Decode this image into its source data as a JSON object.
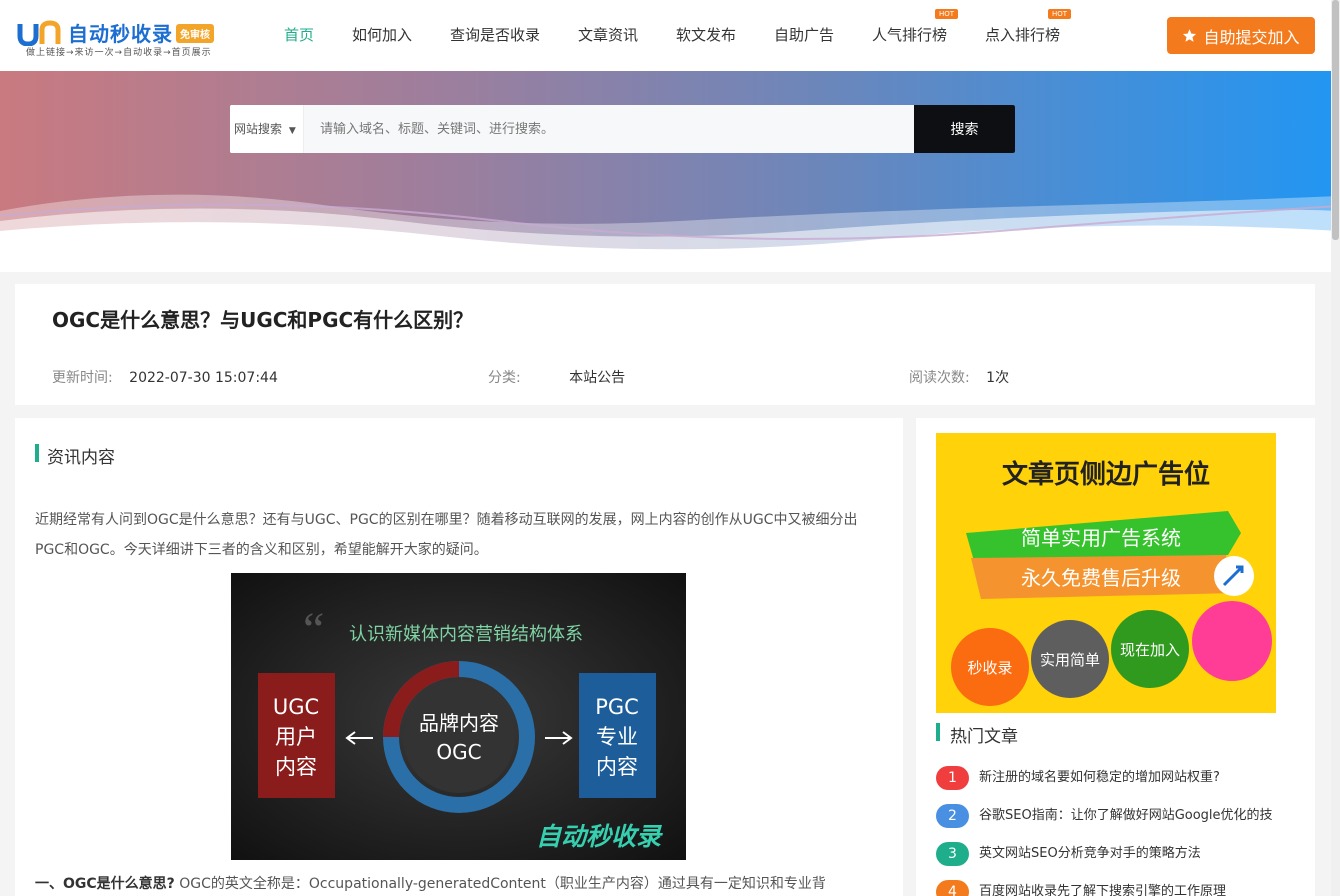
{
  "logo": {
    "title": "自动秒收录",
    "badge": "免审核",
    "slogan": "做上链接→来访一次→自动收录→首页展示"
  },
  "nav": [
    {
      "label": "首页"
    },
    {
      "label": "如何加入"
    },
    {
      "label": "查询是否收录"
    },
    {
      "label": "文章资讯"
    },
    {
      "label": "软文发布"
    },
    {
      "label": "自助广告"
    },
    {
      "label": "人气排行榜",
      "badge": "HOT"
    },
    {
      "label": "点入排行榜",
      "badge": "HOT"
    }
  ],
  "submit_button": {
    "label": "自助提交加入",
    "icon": "star-icon"
  },
  "search": {
    "select_label": "网站搜索",
    "placeholder": "请输入域名、标题、关键词、进行搜索。",
    "button_label": "搜索"
  },
  "article": {
    "title": "OGC是什么意思？与UGC和PGC有什么区别？",
    "meta": {
      "updated_label": "更新时间:",
      "updated_value": "2022-07-30 15:07:44",
      "category_label": "分类:",
      "category_value": "本站公告",
      "views_label": "阅读次数:",
      "views_value": "1次"
    },
    "section_title": "资讯内容",
    "intro": "近期经常有人问到OGC是什么意思？还有与UGC、PGC的区别在哪里？随着移动互联网的发展，网上内容的创作从UGC中又被细分出PGC和OGC。今天详细讲下三者的含义和区别，希望能解开大家的疑问。",
    "figure": {
      "caption": "认识新媒体内容营销结构体系",
      "left_label": [
        "UGC",
        "用户",
        "内容"
      ],
      "center_label": [
        "品牌内容",
        "OGC"
      ],
      "right_label": [
        "PGC",
        "专业",
        "内容"
      ],
      "watermark": "自动秒收录"
    },
    "para2_strong": "一、OGC是什么意思?",
    "para2_text": " OGC的英文全称是：Occupationally-generatedContent（职业生产内容）通过具有一定知识和专业背"
  },
  "sidebar": {
    "ad": {
      "title": "文章页侧边广告位",
      "line1": "简单实用广告系统",
      "line2": "永久免费售后升级",
      "circles": [
        "秒收录",
        "实用简单",
        "现在加入",
        ""
      ]
    },
    "hot_title": "热门文章",
    "hot_list": [
      {
        "rank": "1",
        "text": "新注册的域名要如何稳定的增加网站权重?",
        "color": "#f03e3e"
      },
      {
        "rank": "2",
        "text": "谷歌SEO指南：让你了解做好网站Google优化的技",
        "color": "#4a90e2"
      },
      {
        "rank": "3",
        "text": "英文网站SEO分析竞争对手的策略方法",
        "color": "#1fae8c"
      },
      {
        "rank": "4",
        "text": "百度网站收录先了解下搜索引擎的工作原理",
        "color": "#f37b1d"
      }
    ]
  }
}
